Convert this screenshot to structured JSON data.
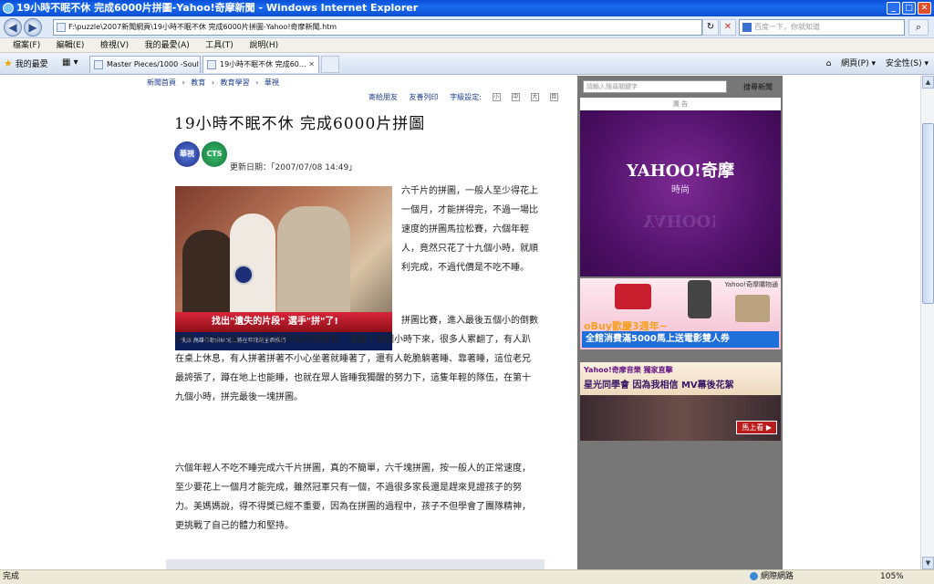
{
  "window": {
    "title": "19小時不眠不休 完成6000片拼圖-Yahoo!奇摩新聞 - Windows Internet Explorer",
    "min": "_",
    "max": "□",
    "close": "✕"
  },
  "address": {
    "url": "F:\\puzzle\\2007新聞網頁\\19小時不眠不休 完成6000片拼圖-Yahoo!奇摩新聞.htm",
    "search_placeholder": "百度一下，你就知道",
    "back": "◀",
    "forward": "▶",
    "refresh": "↻",
    "stop": "✕",
    "go": "⌕"
  },
  "menu": [
    "檔案(F)",
    "編輯(E)",
    "檢視(V)",
    "我的最愛(A)",
    "工具(T)",
    "說明(H)"
  ],
  "tabs": {
    "favorites": "我的最愛",
    "tab1": "Master Pieces/1000 -Soul of t...",
    "tab2": "19小時不眠不休 完成60...",
    "close": "✕",
    "cmd_page": "網頁(P) ▾",
    "cmd_safety": "安全性(S) ▾"
  },
  "article": {
    "breadcrumbs": [
      "新聞首頁",
      "›",
      "教育",
      "›",
      "教育學習",
      "›",
      "華視"
    ],
    "tool_send": "寄給朋友",
    "tool_print": "友善列印",
    "tool_fontsize": "字級設定:",
    "font_buttons": [
      "小",
      "中",
      "大",
      "目"
    ],
    "headline": "19小時不眠不休  完成6000片拼圖",
    "logo_a": "華視",
    "logo_b": "CTS",
    "updated": "更新日期：「2007/07/08 14:49」",
    "photo_caption": "找出\"遺失的片段\" 選手\"拼\"了!",
    "photo_ticker": "快訊 高雄市政府研究...將在年底前全面推行",
    "para1": "六千片的拼圖，一般人至少得花上一個月，才能拼得完，不過一場比速度的拼圖馬拉松賽，六個年輕人，竟然只花了十九個小時，就順利完成，不過代價是不吃不睡。",
    "para2": "拼圖比賽，進入最後五個小的倒數計時，來自全國三百多位選手和時間賽跑，連續十幾個小時下來，很多人累翻了，有人趴在桌上休息，有人拼著拼著不小心坐著就睡著了，還有人乾脆躺著睡、靠著睡，這位老兄最誇張了，蹲在地上也能睡，也就在眾人皆睡我獨醒的努力下，這隻年輕的隊伍，在第十九個小時，拼完最後一塊拼圖。",
    "para3": "六個年輕人不吃不睡完成六千片拼圖，真的不簡單，六千塊拼圖，按一般人的正常速度，至少要花上一個月才能完成，雖然冠軍只有一個，不過很多家長還是趕來見證孩子的努力。美媽媽說，得不得獎已經不重要，因為在拼圖的過程中，孩子不但學會了團隊精神，更挑戰了自己的體力和堅持。"
  },
  "sidebar": {
    "search_placeholder": "請輸入搜尋關鍵字",
    "search_label": "搜尋新聞",
    "ad_label": "廣  告",
    "ad1_brand": "YAHOO!奇摩",
    "ad1_sub": "時尚",
    "ad2_label": "Yahoo!奇摩購物通",
    "ad2_text1": "oBuy歡慶3週年~",
    "ad2_text2": "全館消費滿5000馬上送電影雙人券",
    "ad3_text1": "Yahoo!奇摩音樂 獨家直擊",
    "ad3_text2": "星光同學會  因為我相信 MV幕後花絮",
    "ad3_more": "馬上看 ▶"
  },
  "status": {
    "text": "完成",
    "zone": "網際網路",
    "zoom": "105%"
  },
  "colors": {
    "title_blue": "#0a4ed8",
    "link_blue": "#1e3e8c",
    "ad_purple": "#4a0e62",
    "sidebar_gray": "#777777"
  }
}
